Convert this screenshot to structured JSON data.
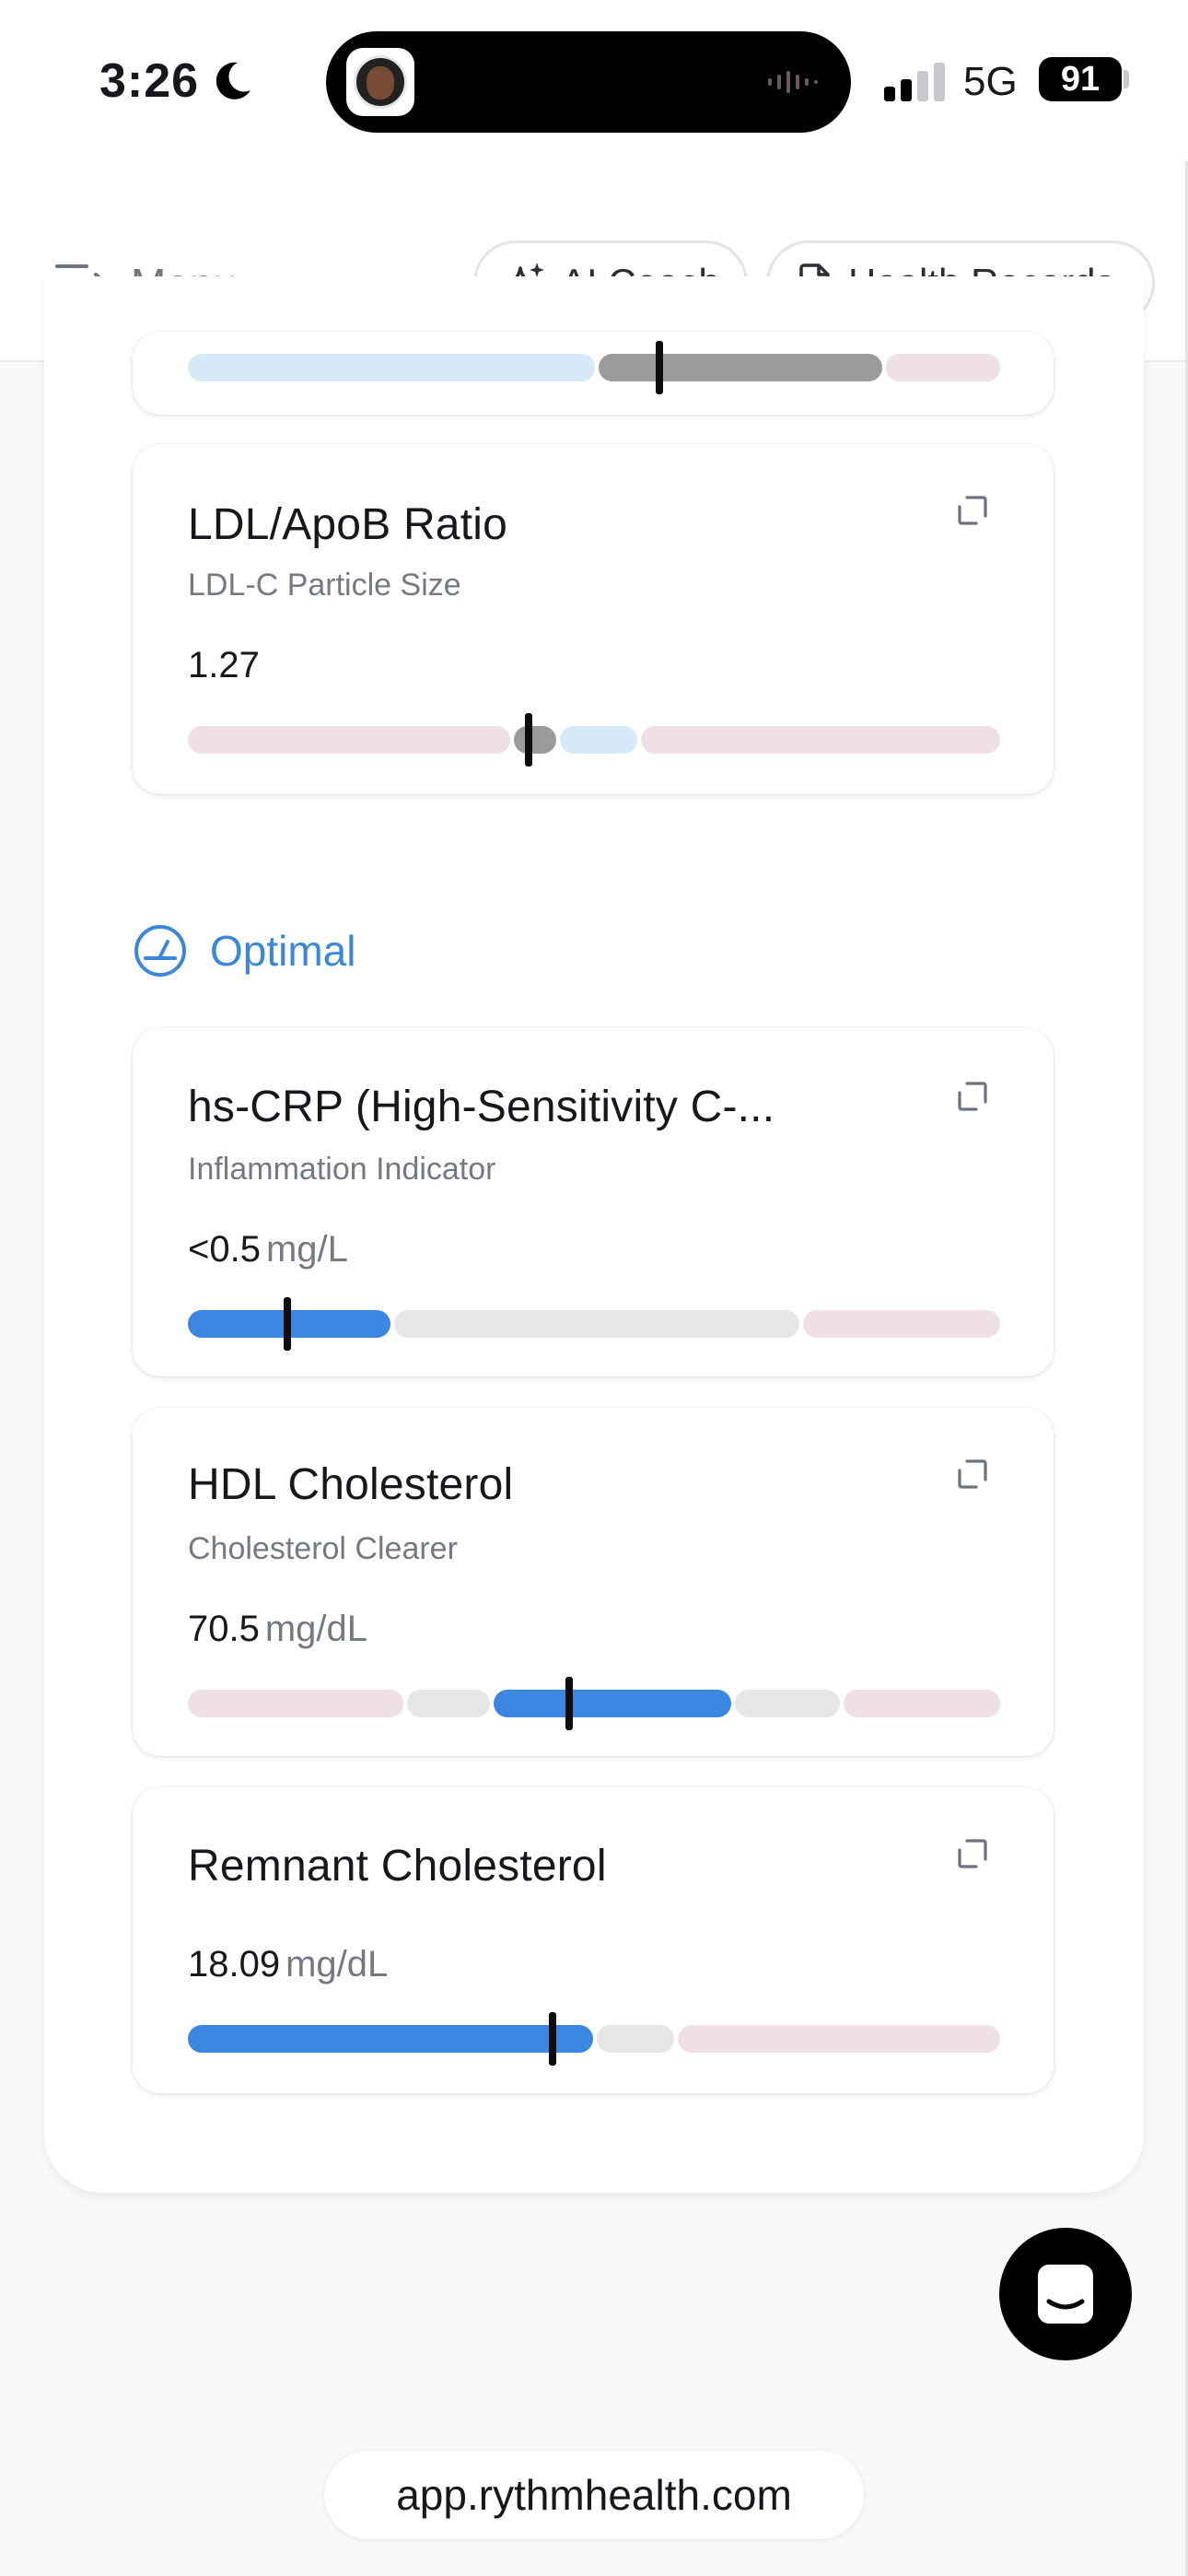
{
  "status_bar": {
    "time": "3:26",
    "network": "5G",
    "battery": "91"
  },
  "nav": {
    "menu_label": "Menu",
    "ai_coach_label": "AI Coach",
    "health_records_label": "Health Records"
  },
  "cards_top": [
    {
      "title": "LDL/ApoB Ratio",
      "subtitle": "LDL-C Particle Size",
      "value": "1.27",
      "unit": ""
    }
  ],
  "section": {
    "label": "Optimal"
  },
  "cards_optimal": [
    {
      "title": "hs-CRP (High-Sensitivity C-...",
      "subtitle": "Inflammation Indicator",
      "value": "<0.5",
      "unit": "mg/L"
    },
    {
      "title": "HDL Cholesterol",
      "subtitle": "Cholesterol Clearer",
      "value": "70.5",
      "unit": "mg/dL"
    },
    {
      "title": "Remnant Cholesterol",
      "subtitle": "",
      "value": "18.09",
      "unit": "mg/dL"
    }
  ],
  "colors": {
    "optimal": "#3b87e0",
    "normal": "#e6e6e6",
    "risk": "#efe0e5",
    "borderline": "#d6e9f7",
    "current_gray": "#9b9b9b"
  },
  "icons": {
    "expand": "expand-icon",
    "gauge": "gauge-icon",
    "sparkle": "sparkle-icon",
    "document": "document-icon",
    "menu": "menu-icon",
    "chat": "chat-icon"
  },
  "browser": {
    "url": "app.rythmhealth.com"
  }
}
